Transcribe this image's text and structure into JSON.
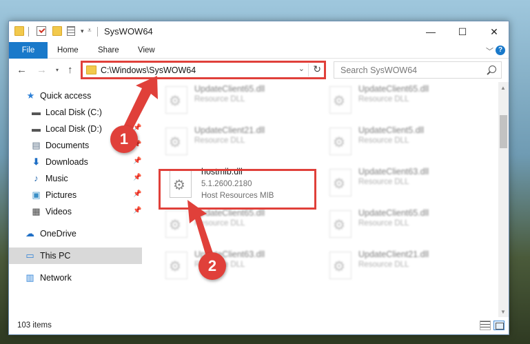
{
  "window": {
    "title": "SysWOW64"
  },
  "ribbon": {
    "tabs": [
      "File",
      "Home",
      "Share",
      "View"
    ],
    "help_label": "?"
  },
  "nav": {
    "address": "C:\\Windows\\SysWOW64",
    "search_placeholder": "Search SysWOW64"
  },
  "sidebar": {
    "items": [
      {
        "label": "Quick access",
        "icon": "star-icon"
      },
      {
        "label": "Local Disk (C:)",
        "icon": "drive-icon"
      },
      {
        "label": "Local Disk (D:)",
        "icon": "drive-icon"
      },
      {
        "label": "Documents",
        "icon": "documents-icon"
      },
      {
        "label": "Downloads",
        "icon": "download-arrow-icon"
      },
      {
        "label": "Music",
        "icon": "music-note-icon"
      },
      {
        "label": "Pictures",
        "icon": "pictures-icon"
      },
      {
        "label": "Videos",
        "icon": "film-icon"
      },
      {
        "label": "OneDrive",
        "icon": "cloud-icon"
      },
      {
        "label": "This PC",
        "icon": "monitor-icon"
      },
      {
        "label": "Network",
        "icon": "network-icon"
      }
    ],
    "selected": "This PC"
  },
  "files": [
    {
      "name": "UpdateClient65.dll",
      "type": "Resource DLL"
    },
    {
      "name": "UpdateClient65.dll",
      "type": "Resource DLL"
    },
    {
      "name": "UpdateClient21.dll",
      "type": "Resource DLL"
    },
    {
      "name": "UpdateClient5.dll",
      "type": "Resource DLL"
    },
    {
      "name": "hostmib.dll",
      "version": "5.1.2600.2180",
      "type": "Host Resources MIB"
    },
    {
      "name": "UpdateClient63.dll",
      "type": "Resource DLL"
    },
    {
      "name": "UpdateClient65.dll",
      "type": "Resource DLL"
    },
    {
      "name": "UpdateClient65.dll",
      "type": "Resource DLL"
    },
    {
      "name": "UpdateClient63.dll",
      "type": "Resource DLL"
    },
    {
      "name": "UpdateClient21.dll",
      "type": "Resource DLL"
    }
  ],
  "status": {
    "item_count": "103 items"
  },
  "annotations": {
    "step1": "1",
    "step2": "2",
    "color": "#e0403a"
  }
}
